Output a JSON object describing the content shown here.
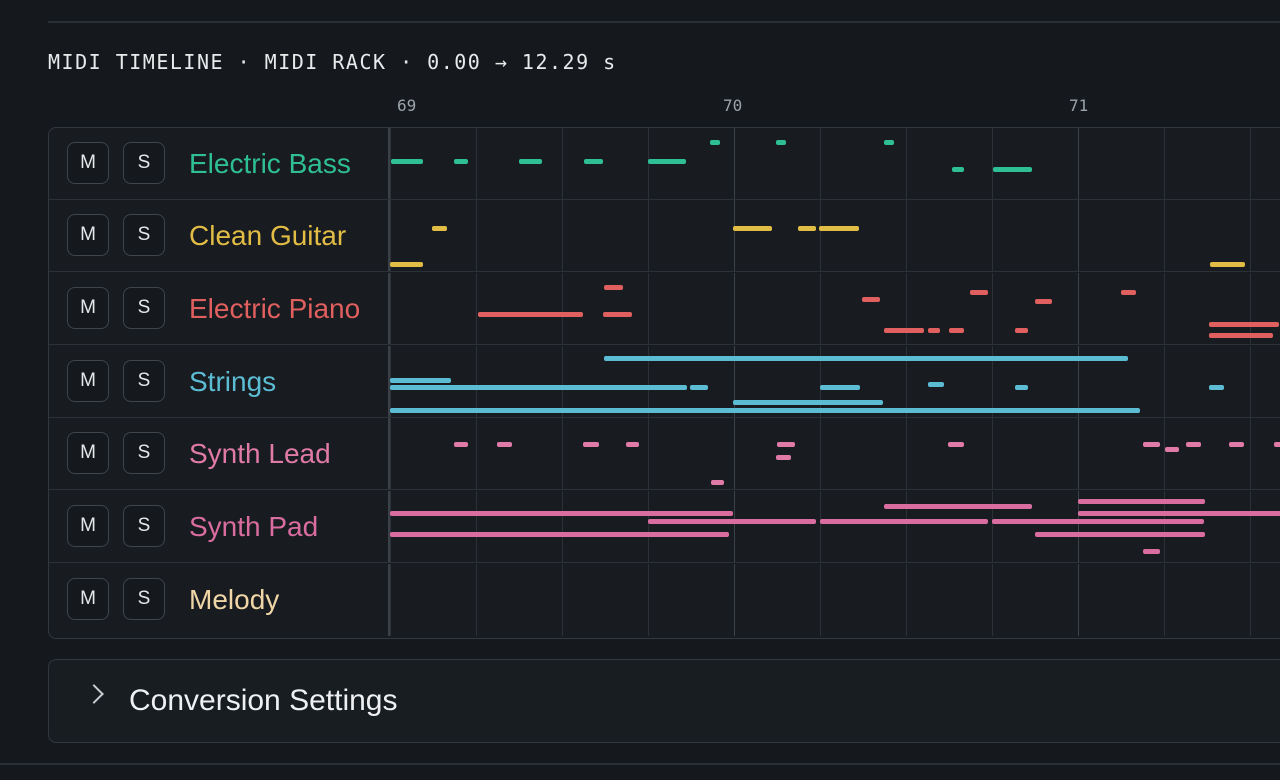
{
  "header": {
    "title": "MIDI TIMELINE · MIDI RACK · 0.00 → 12.29 s"
  },
  "ruler": {
    "labels": [
      "69",
      "70",
      "71"
    ]
  },
  "track_controls": {
    "mute_label": "M",
    "solo_label": "S"
  },
  "tracks": [
    {
      "name": "Electric Bass",
      "color": "#2fbf94"
    },
    {
      "name": "Clean Guitar",
      "color": "#e2bd45"
    },
    {
      "name": "Electric Piano",
      "color": "#e05f5f"
    },
    {
      "name": "Strings",
      "color": "#5bbcd3"
    },
    {
      "name": "Synth Lead",
      "color": "#e07aa6"
    },
    {
      "name": "Synth Pad",
      "color": "#d96d9f"
    },
    {
      "name": "Melody",
      "color": "#f0d6a6"
    }
  ],
  "settings": {
    "label": "Conversion Settings",
    "icon": "chevron-right-icon"
  }
}
